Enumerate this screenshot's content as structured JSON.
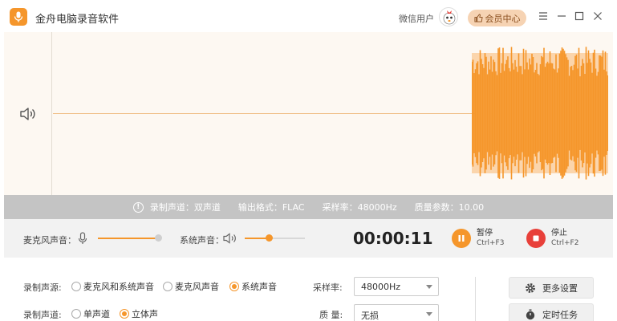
{
  "app": {
    "title": "金舟电脑录音软件",
    "user": "微信用户",
    "vip": "会员中心"
  },
  "colors": {
    "accent": "#f5962b",
    "stop": "#e8403a"
  },
  "info": {
    "channel": "录制声道：双声道",
    "format": "输出格式：FLAC",
    "rate": "采样率：48000Hz",
    "quality": "质量参数：10.00"
  },
  "controls": {
    "mic_label": "麦克风声音：",
    "mic_level": 1.0,
    "sys_label": "系统声音：",
    "sys_level": 0.4,
    "timer": "00:00:11",
    "pause_label": "暂停",
    "pause_shortcut": "Ctrl+F3",
    "stop_label": "停止",
    "stop_shortcut": "Ctrl+F2"
  },
  "settings": {
    "source_label": "录制声源:",
    "source_options": [
      "麦克风和系统声音",
      "麦克风声音",
      "系统声音"
    ],
    "source_selected": 2,
    "channel_label": "录制声道:",
    "channel_options": [
      "单声道",
      "立体声"
    ],
    "channel_selected": 1,
    "rate_label": "采样率:",
    "rate_value": "48000Hz",
    "quality_label": "质  量:",
    "quality_value": "无损",
    "more_settings": "更多设置",
    "timed_task": "定时任务"
  }
}
